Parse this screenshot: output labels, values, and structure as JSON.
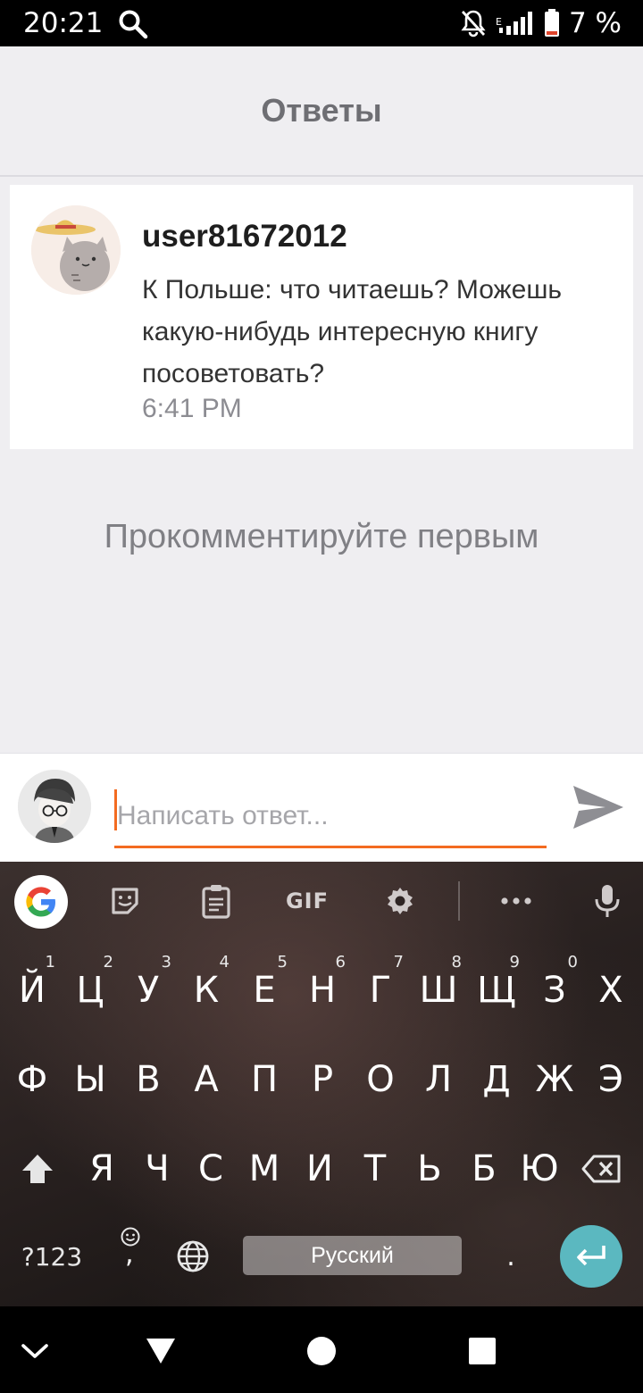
{
  "status_bar": {
    "time": "20:21",
    "battery": "7 %",
    "icons": [
      "search-icon",
      "notifications-off-icon",
      "signal-icon",
      "battery-icon"
    ]
  },
  "header": {
    "title": "Ответы"
  },
  "post": {
    "username": "user81672012",
    "text": "К Польше: что читаешь? Можешь какую-нибудь интересную книгу посоветовать?",
    "time": "6:41 PM"
  },
  "empty_state": "Прокомментируйте первым",
  "reply": {
    "placeholder": "Написать ответ...",
    "accent_color": "#f36b21",
    "send_icon": "send-icon"
  },
  "keyboard": {
    "toolbar": [
      "google-icon",
      "sticker-icon",
      "clipboard-icon",
      "GIF",
      "gear-icon",
      "more-icon",
      "mic-icon"
    ],
    "gif_label": "GIF",
    "row1": [
      "Й",
      "Ц",
      "У",
      "К",
      "Е",
      "Н",
      "Г",
      "Ш",
      "Щ",
      "З",
      "Х"
    ],
    "row1_hints": [
      "1",
      "2",
      "3",
      "4",
      "5",
      "6",
      "7",
      "8",
      "9",
      "0"
    ],
    "row2": [
      "Ф",
      "Ы",
      "В",
      "А",
      "П",
      "Р",
      "О",
      "Л",
      "Д",
      "Ж",
      "Э"
    ],
    "row3": [
      "Я",
      "Ч",
      "С",
      "М",
      "И",
      "Т",
      "Ь",
      "Б",
      "Ю"
    ],
    "symbols_label": "?123",
    "comma_label": ",",
    "space_label": "Русский",
    "period_label": ".",
    "enter_color": "#5bb8c0"
  },
  "nav_bar": [
    "back-icon",
    "home-icon",
    "recents-icon",
    "hide-keyboard-icon"
  ]
}
